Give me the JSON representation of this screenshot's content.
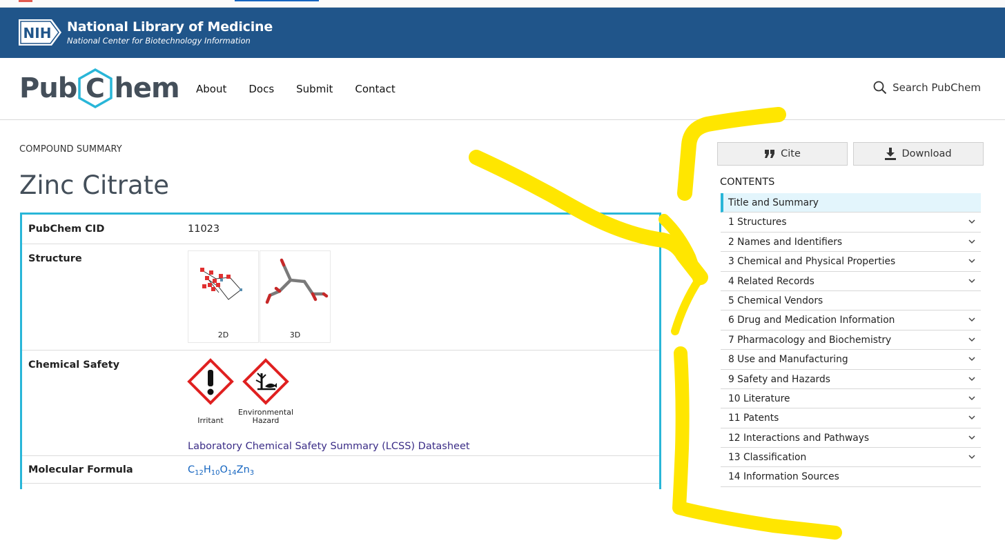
{
  "nih": {
    "logo_text": "NIH",
    "title": "National Library of Medicine",
    "subtitle": "National Center for Biotechnology Information"
  },
  "header": {
    "logo_prefix": "Pub",
    "logo_letter": "C",
    "logo_suffix": "hem",
    "nav": [
      "About",
      "Docs",
      "Submit",
      "Contact"
    ],
    "search_label": "Search PubChem"
  },
  "page": {
    "section_label": "COMPOUND SUMMARY",
    "title": "Zinc Citrate"
  },
  "summary": {
    "cid_label": "PubChem CID",
    "cid_value": "11023",
    "structure_label": "Structure",
    "structure_2d": "2D",
    "structure_3d": "3D",
    "safety_label": "Chemical Safety",
    "hazard_1": "Irritant",
    "hazard_2_line1": "Environmental",
    "hazard_2_line2": "Hazard",
    "lcss_link": "Laboratory Chemical Safety Summary (LCSS) Datasheet",
    "formula_label": "Molecular Formula",
    "formula": {
      "c": "C",
      "c_n": "12",
      "h": "H",
      "h_n": "10",
      "o": "O",
      "o_n": "14",
      "zn": "Zn",
      "zn_n": "3"
    }
  },
  "actions": {
    "cite": "Cite",
    "download": "Download"
  },
  "contents": {
    "title": "CONTENTS",
    "items": [
      {
        "label": "Title and Summary",
        "expandable": false
      },
      {
        "label": "1 Structures",
        "expandable": true
      },
      {
        "label": "2 Names and Identifiers",
        "expandable": true
      },
      {
        "label": "3 Chemical and Physical Properties",
        "expandable": true
      },
      {
        "label": "4 Related Records",
        "expandable": true
      },
      {
        "label": "5 Chemical Vendors",
        "expandable": false
      },
      {
        "label": "6 Drug and Medication Information",
        "expandable": true
      },
      {
        "label": "7 Pharmacology and Biochemistry",
        "expandable": true
      },
      {
        "label": "8 Use and Manufacturing",
        "expandable": true
      },
      {
        "label": "9 Safety and Hazards",
        "expandable": true
      },
      {
        "label": "10 Literature",
        "expandable": true
      },
      {
        "label": "11 Patents",
        "expandable": true
      },
      {
        "label": "12 Interactions and Pathways",
        "expandable": true
      },
      {
        "label": "13 Classification",
        "expandable": true
      },
      {
        "label": "14 Information Sources",
        "expandable": false
      }
    ]
  },
  "colors": {
    "nih_blue": "#20558a",
    "accent_cyan": "#29b6d8",
    "logo_gray": "#444f5a",
    "link_purple": "#3a2c86",
    "formula_blue": "#1565c0",
    "annotation_yellow": "#ffe600"
  }
}
